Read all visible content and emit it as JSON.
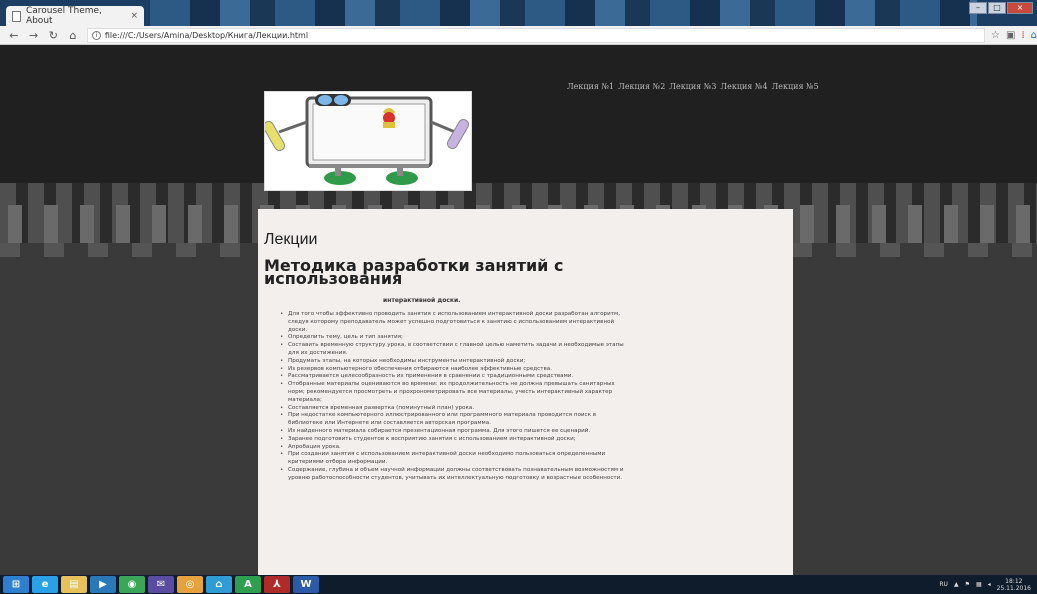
{
  "browser": {
    "tab_title": "Carousel Theme, About",
    "tab_close": "×",
    "url": "file:///C:/Users/Amina/Desktop/Книга/Лекции.html",
    "window_controls": [
      "–",
      "□",
      "×"
    ]
  },
  "site": {
    "menu": [
      "Лекция №1",
      "Лекция №2",
      "Лекция №3",
      "Лекция №4",
      "Лекция №5"
    ],
    "section_title": "Лекции",
    "article_title": "Методика разработки занятий с использования",
    "article_subtitle": "интерактивной доски.",
    "items": [
      "Для того чтобы эффективно проводить занятия с использованием интерактивной доски разработан алгоритм, следуя которому преподаватель может успешно подготовиться к занятию с использованием интерактивной доски.",
      "Определить тему, цель и тип занятия;",
      "Составить временную структуру урока, в соответствии с главной целью наметить задачи и необходимые этапы для их достижения.",
      "Продумать этапы, на которых необходимы инструменты интерактивной доски;",
      "Из резервов компьютерного обеспечения отбираются наиболее эффективные средства.",
      "Рассматривается целесообразность их применения в сравнении с традиционными средствами.",
      "Отобранные материалы оцениваются во времени: их продолжительность не должна превышать санитарных норм; рекомендуется просмотреть и прохронометрировать все материалы, учесть интерактивный характер материала;",
      "Составляется временная развертка (поминутный план) урока.",
      "При недостатке компьютерного иллюстрированного или программного материала проводится поиск в библиотеке или Интернете или составляется авторская программа.",
      "Из найденного материала собирается презентационная программа. Для этого пишется ее сценарий.",
      "Заранее подготовить студентов к восприятию занятия с использованием интерактивной доски;",
      "Апробация урока.",
      "При создании занятия с использованием интерактивной доски необходимо пользоваться определенными критериями отбора информации.",
      "Содержание, глубина и объем научной информации должны соответствовать познавательным возможностям и уровню работоспособности студентов, учитывать их интеллектуальную подготовку и возрастные особенности."
    ]
  },
  "taskbar": {
    "apps": [
      {
        "icon": "windows-start-icon",
        "color": "#2f7fd0"
      },
      {
        "icon": "internet-explorer-icon",
        "color": "#2aa0e8"
      },
      {
        "icon": "file-explorer-icon",
        "color": "#e7c15a"
      },
      {
        "icon": "media-player-icon",
        "color": "#2b78b9"
      },
      {
        "icon": "chrome-icon",
        "color": "#3aa657"
      },
      {
        "icon": "mail-icon",
        "color": "#5a4ca0"
      },
      {
        "icon": "search-app-icon",
        "color": "#e6a23c"
      },
      {
        "icon": "home-app-icon",
        "color": "#2f9cd6"
      },
      {
        "icon": "access-icon",
        "color": "#2e9e4f"
      },
      {
        "icon": "acrobat-icon",
        "color": "#b02a2a"
      },
      {
        "icon": "word-icon",
        "color": "#2b5aa8"
      }
    ],
    "language": "RU",
    "time": "18:12",
    "date": "25.11.2016"
  }
}
